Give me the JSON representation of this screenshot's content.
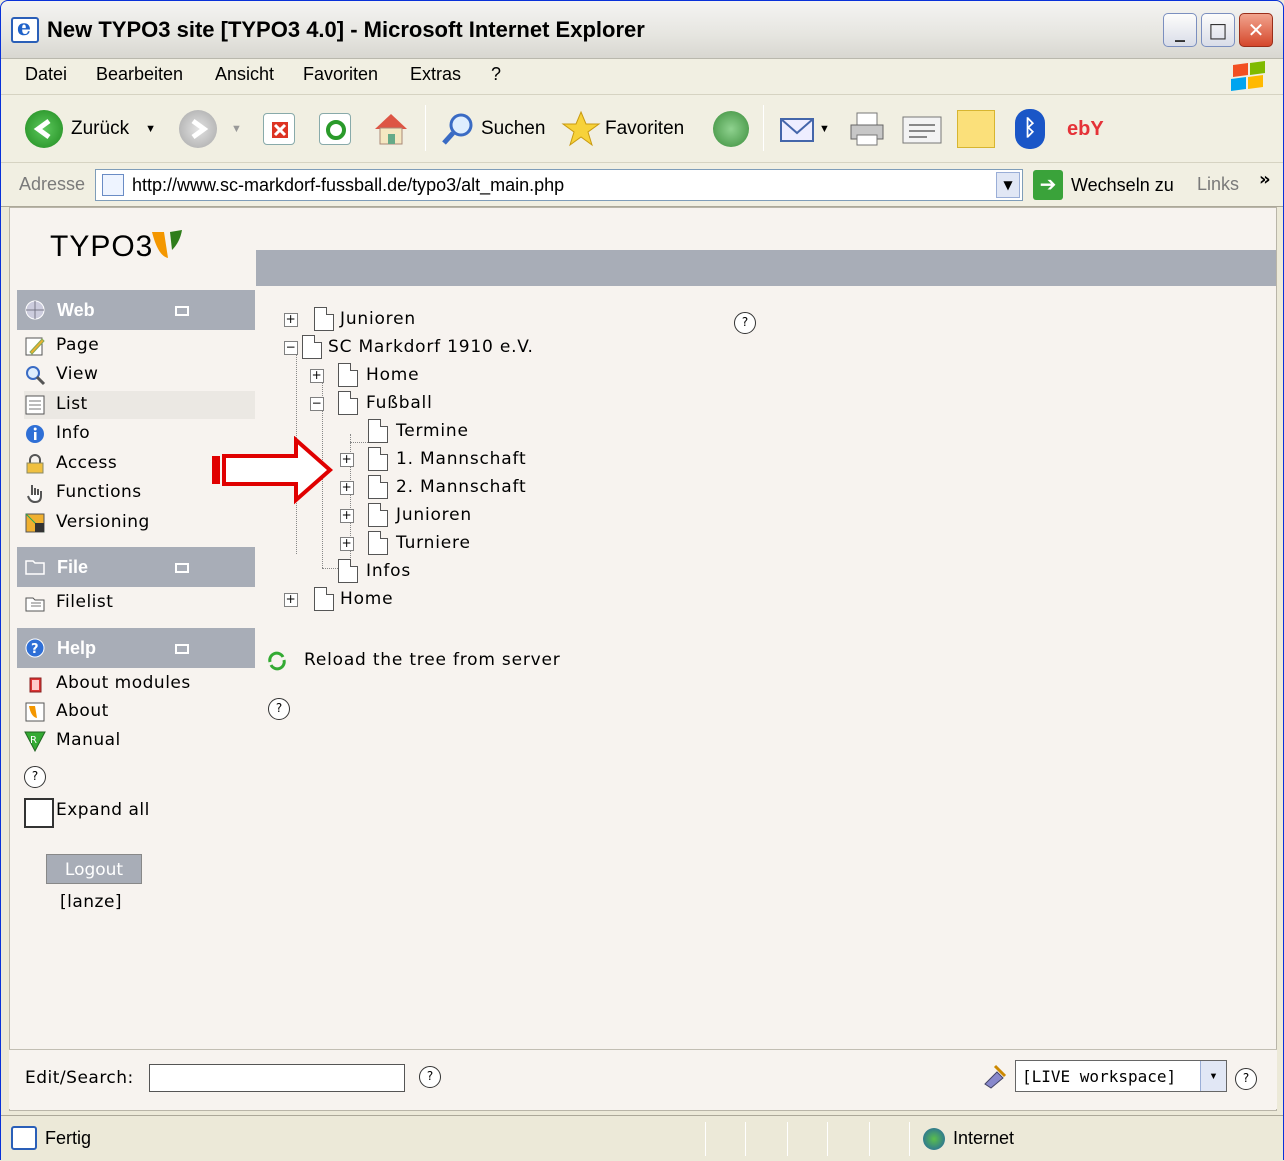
{
  "window": {
    "title": "New TYPO3 site [TYPO3 4.0] - Microsoft Internet Explorer",
    "minimize": "_",
    "maximize": "□",
    "close": "✕"
  },
  "menu": [
    "Datei",
    "Bearbeiten",
    "Ansicht",
    "Favoriten",
    "Extras",
    "?"
  ],
  "toolbar": {
    "back": "Zurück",
    "search": "Suchen",
    "favorites": "Favoriten",
    "ebay": "ebY"
  },
  "address": {
    "label": "Adresse",
    "url": "http://www.sc-markdorf-fussball.de/typo3/alt_main.php",
    "go": "Wechseln zu",
    "links": "Links",
    "chevron": "»"
  },
  "brand": {
    "logo_text": "TYPO3"
  },
  "modules": {
    "web": {
      "title": "Web",
      "items": [
        "Page",
        "View",
        "List",
        "Info",
        "Access",
        "Functions",
        "Versioning"
      ],
      "selected": "List"
    },
    "file": {
      "title": "File",
      "items": [
        "Filelist"
      ]
    },
    "help": {
      "title": "Help",
      "items": [
        "About modules",
        "About",
        "Manual"
      ]
    }
  },
  "expand_all": "Expand all",
  "logout": "Logout",
  "user": "[lanze]",
  "help_glyph": "?",
  "tree": {
    "nodes": [
      {
        "label": "Junioren",
        "toggle": "+"
      },
      {
        "label": "SC Markdorf 1910 e.V.",
        "toggle": "−"
      },
      {
        "label": "Home",
        "toggle": "+"
      },
      {
        "label": "Fußball",
        "toggle": "−"
      },
      {
        "label": "Termine",
        "toggle": ""
      },
      {
        "label": "1. Mannschaft",
        "toggle": "+"
      },
      {
        "label": "2. Mannschaft",
        "toggle": "+"
      },
      {
        "label": "Junioren",
        "toggle": "+"
      },
      {
        "label": "Turniere",
        "toggle": "+"
      },
      {
        "label": "Infos",
        "toggle": ""
      },
      {
        "label": "Home",
        "toggle": "+"
      }
    ],
    "reload": "Reload the tree from server"
  },
  "footer": {
    "edit_search_label": "Edit/Search:",
    "workspace": "[LIVE workspace]",
    "dd": "▾"
  },
  "status": {
    "text": "Fertig",
    "zone": "Internet"
  },
  "colors": {
    "header_bg": "#a8adb7",
    "arrow": "#e00000",
    "page_bg": "#f7f3ef"
  }
}
